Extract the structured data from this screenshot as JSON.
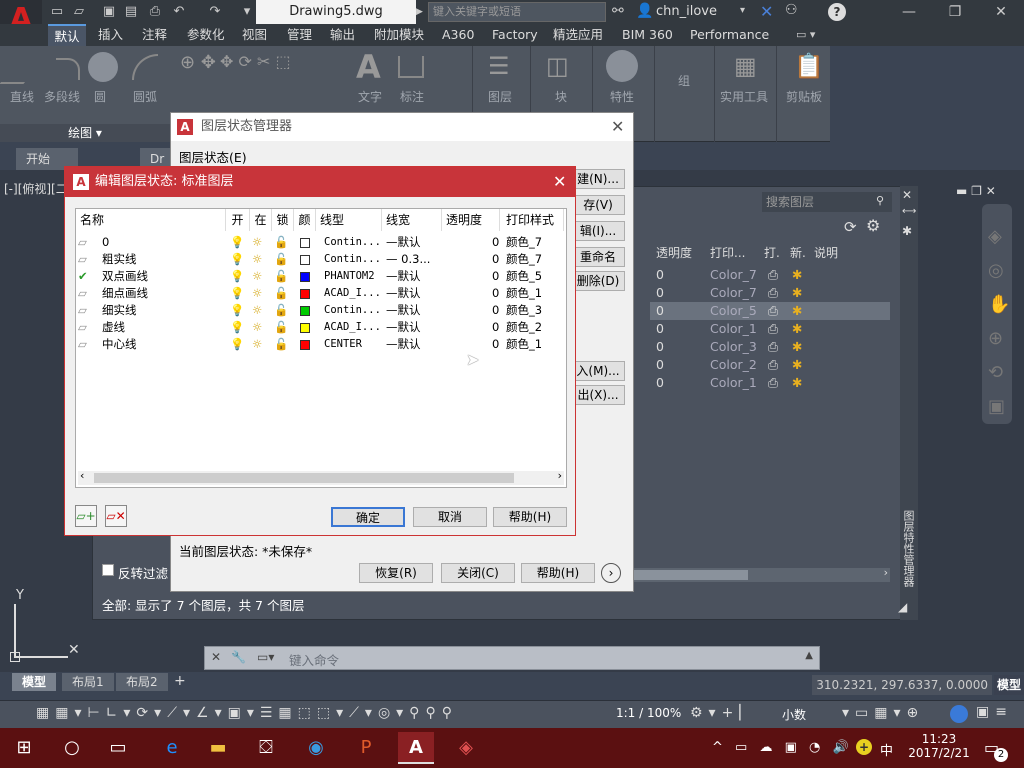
{
  "app": {
    "logo_letter": "A",
    "filename": "Drawing5.dwg",
    "search_placeholder": "键入关键字或短语",
    "user": "chn_ilove"
  },
  "ribbon": {
    "tabs": [
      "默认",
      "插入",
      "注释",
      "参数化",
      "视图",
      "管理",
      "输出",
      "附加模块",
      "A360",
      "Factory",
      "精选应用",
      "BIM 360",
      "Performance"
    ],
    "tools": [
      "直线",
      "多段线",
      "圆",
      "圆弧",
      "文字",
      "标注",
      "图层",
      "块",
      "特性",
      "组",
      "实用工具",
      "剪贴板"
    ],
    "panel_draw": "绘图 ▾"
  },
  "filetabs": [
    "开始",
    "Dr"
  ],
  "viewport_label": "[-][俯视][二",
  "palette": {
    "search": "搜索图层",
    "headers": [
      "透明度",
      "打印...",
      "打.",
      "新.",
      "说明"
    ],
    "rows": [
      {
        "trans": "0",
        "plot": "Color_7"
      },
      {
        "trans": "0",
        "plot": "Color_7"
      },
      {
        "trans": "0",
        "plot": "Color_5"
      },
      {
        "trans": "0",
        "plot": "Color_1"
      },
      {
        "trans": "0",
        "plot": "Color_3"
      },
      {
        "trans": "0",
        "plot": "Color_2"
      },
      {
        "trans": "0",
        "plot": "Color_1"
      }
    ],
    "invert_filter": "反转过滤",
    "summary": "全部: 显示了 7 个图层，共 7 个图层",
    "side_title": "图层特性管理器"
  },
  "lsm": {
    "title": "图层状态管理器",
    "state_label": "图层状态(E)",
    "buttons": [
      "建(N)...",
      "存(V)",
      "辑(I)...",
      "重命名",
      "删除(D)",
      "入(M)...",
      "出(X)..."
    ],
    "current_state": "当前图层状态: *未保存*",
    "restore": "恢复(R)",
    "close": "关闭(C)",
    "help": "帮助(H)"
  },
  "edit": {
    "title": "编辑图层状态: 标准图层",
    "headers": [
      "名称",
      "开",
      "在",
      "锁",
      "颜",
      "线型",
      "线宽",
      "透明度",
      "打印样式"
    ],
    "rows": [
      {
        "name": "0",
        "color": "#ffffff",
        "ltype": "Contin...",
        "lw": "—默认",
        "tr": "0",
        "ps": "颜色_7",
        "current": false
      },
      {
        "name": "粗实线",
        "color": "#ffffff",
        "ltype": "Contin...",
        "lw": "— 0.3...",
        "tr": "0",
        "ps": "颜色_7",
        "current": false
      },
      {
        "name": "双点画线",
        "color": "#0000ff",
        "ltype": "PHANTOM2",
        "lw": "—默认",
        "tr": "0",
        "ps": "颜色_5",
        "current": true
      },
      {
        "name": "细点画线",
        "color": "#ff0000",
        "ltype": "ACAD_I...",
        "lw": "—默认",
        "tr": "0",
        "ps": "颜色_1",
        "current": false
      },
      {
        "name": "细实线",
        "color": "#00cc00",
        "ltype": "Contin...",
        "lw": "—默认",
        "tr": "0",
        "ps": "颜色_3",
        "current": false
      },
      {
        "name": "虚线",
        "color": "#ffff00",
        "ltype": "ACAD_I...",
        "lw": "—默认",
        "tr": "0",
        "ps": "颜色_2",
        "current": false
      },
      {
        "name": "中心线",
        "color": "#ff0000",
        "ltype": "CENTER",
        "lw": "—默认",
        "tr": "0",
        "ps": "颜色_1",
        "current": false
      }
    ],
    "ok": "确定",
    "cancel": "取消",
    "help": "帮助(H)"
  },
  "command": {
    "placeholder": "键入命令"
  },
  "layout_tabs": [
    "模型",
    "布局1",
    "布局2"
  ],
  "status": {
    "coords": "310.2321, 297.6337, 0.0000",
    "model": "模型",
    "scale": "1:1 / 100%",
    "units": "小数"
  },
  "taskbar": {
    "time": "11:23",
    "date": "2017/2/21",
    "ime": "中",
    "notif": "2"
  }
}
